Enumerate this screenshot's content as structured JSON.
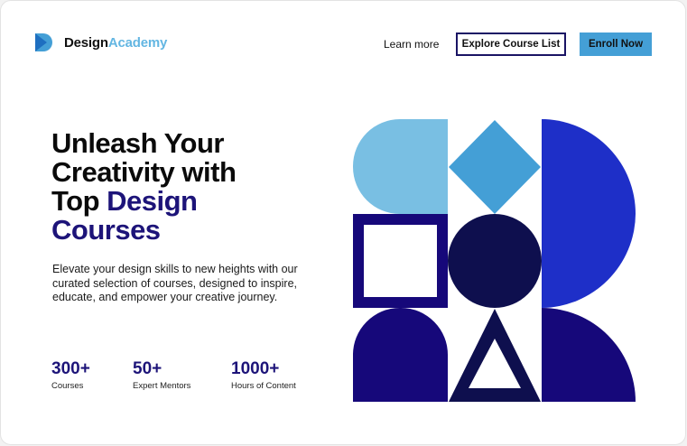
{
  "brand": {
    "name_part1": "Design",
    "name_part2": "Academy",
    "icon": "play-logo-icon",
    "colors": {
      "dark": "#1d1479",
      "light": "#63b6e2"
    }
  },
  "nav": {
    "learn_more": "Learn more",
    "explore_button": "Explore Course List",
    "enroll_button": "Enroll Now"
  },
  "hero": {
    "title_line1": "Unleash Your",
    "title_line2": "Creativity with",
    "title_line3_plain": "Top ",
    "title_line3_accent": "Design",
    "title_line4_accent": "Courses",
    "description": "Elevate your design skills to new heights with our curated selection of courses, designed to inspire, educate, and empower your creative journey."
  },
  "stats": [
    {
      "value": "300+",
      "label": "Courses"
    },
    {
      "value": "50+",
      "label": "Expert Mentors"
    },
    {
      "value": "1000+",
      "label": "Hours of Content"
    }
  ],
  "illustration": {
    "shapes": [
      "rounded-block",
      "diamond",
      "half-circle",
      "square-outline",
      "circle",
      "half-circle",
      "arch",
      "triangle-outline",
      "quarter-shape"
    ],
    "colors": {
      "light_blue": "#79bfe3",
      "mid_blue": "#449fd6",
      "royal_blue": "#1e2fc8",
      "indigo": "#16087a",
      "navy": "#0e0f4e"
    }
  }
}
